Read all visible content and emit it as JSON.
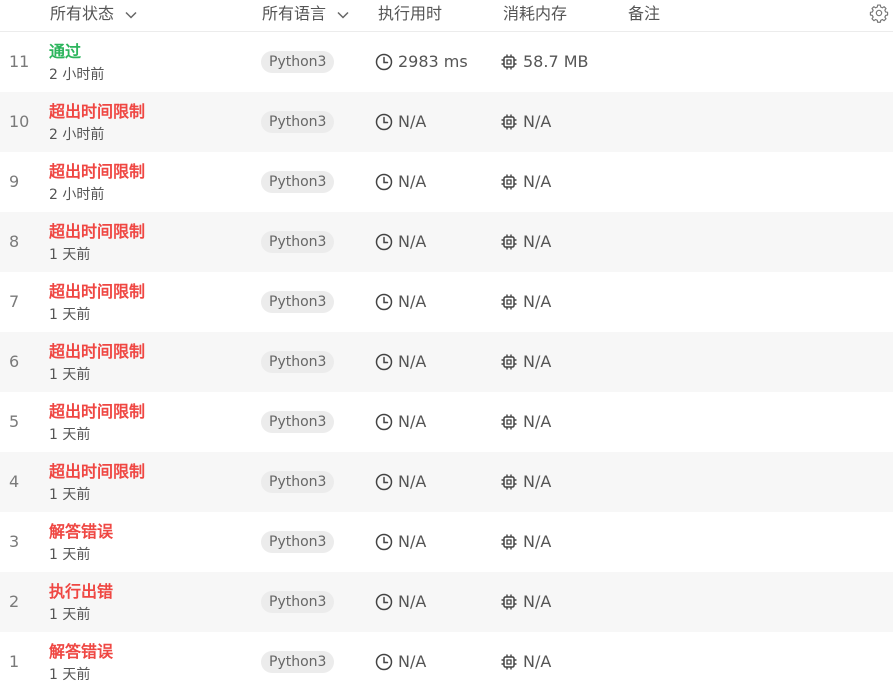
{
  "header": {
    "status_label": "所有状态",
    "language_label": "所有语言",
    "runtime_label": "执行用时",
    "memory_label": "消耗内存",
    "notes_label": "备注",
    "settings_icon": "gear-icon"
  },
  "colors": {
    "accepted": "#2db55d",
    "error": "#ef4743"
  },
  "submissions": [
    {
      "index": "11",
      "status": "通过",
      "status_kind": "accepted",
      "time": "2 小时前",
      "language": "Python3",
      "runtime": "2983 ms",
      "memory": "58.7 MB"
    },
    {
      "index": "10",
      "status": "超出时间限制",
      "status_kind": "error",
      "time": "2 小时前",
      "language": "Python3",
      "runtime": "N/A",
      "memory": "N/A"
    },
    {
      "index": "9",
      "status": "超出时间限制",
      "status_kind": "error",
      "time": "2 小时前",
      "language": "Python3",
      "runtime": "N/A",
      "memory": "N/A"
    },
    {
      "index": "8",
      "status": "超出时间限制",
      "status_kind": "error",
      "time": "1 天前",
      "language": "Python3",
      "runtime": "N/A",
      "memory": "N/A"
    },
    {
      "index": "7",
      "status": "超出时间限制",
      "status_kind": "error",
      "time": "1 天前",
      "language": "Python3",
      "runtime": "N/A",
      "memory": "N/A"
    },
    {
      "index": "6",
      "status": "超出时间限制",
      "status_kind": "error",
      "time": "1 天前",
      "language": "Python3",
      "runtime": "N/A",
      "memory": "N/A"
    },
    {
      "index": "5",
      "status": "超出时间限制",
      "status_kind": "error",
      "time": "1 天前",
      "language": "Python3",
      "runtime": "N/A",
      "memory": "N/A"
    },
    {
      "index": "4",
      "status": "超出时间限制",
      "status_kind": "error",
      "time": "1 天前",
      "language": "Python3",
      "runtime": "N/A",
      "memory": "N/A"
    },
    {
      "index": "3",
      "status": "解答错误",
      "status_kind": "error",
      "time": "1 天前",
      "language": "Python3",
      "runtime": "N/A",
      "memory": "N/A"
    },
    {
      "index": "2",
      "status": "执行出错",
      "status_kind": "error",
      "time": "1 天前",
      "language": "Python3",
      "runtime": "N/A",
      "memory": "N/A"
    },
    {
      "index": "1",
      "status": "解答错误",
      "status_kind": "error",
      "time": "1 天前",
      "language": "Python3",
      "runtime": "N/A",
      "memory": "N/A"
    }
  ]
}
